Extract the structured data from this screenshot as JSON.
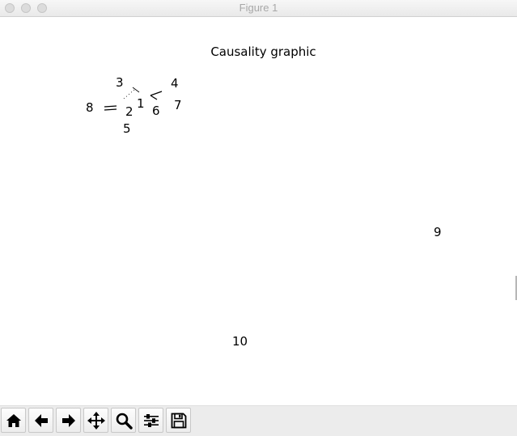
{
  "window": {
    "title": "Figure 1"
  },
  "figure": {
    "title": "Causality graphic",
    "nodes": [
      {
        "id": "n1",
        "label": "1"
      },
      {
        "id": "n2",
        "label": "2"
      },
      {
        "id": "n3",
        "label": "3"
      },
      {
        "id": "n4",
        "label": "4"
      },
      {
        "id": "n5",
        "label": "5"
      },
      {
        "id": "n6",
        "label": "6"
      },
      {
        "id": "n7",
        "label": "7"
      },
      {
        "id": "n8",
        "label": "8"
      },
      {
        "id": "n9",
        "label": "9"
      },
      {
        "id": "n10",
        "label": "10"
      }
    ]
  },
  "toolbar": {
    "buttons": [
      {
        "name": "home",
        "icon": "home-icon"
      },
      {
        "name": "back",
        "icon": "arrow-left-icon"
      },
      {
        "name": "forward",
        "icon": "arrow-right-icon"
      },
      {
        "name": "pan",
        "icon": "move-icon"
      },
      {
        "name": "zoom",
        "icon": "magnifier-icon"
      },
      {
        "name": "configure-subplots",
        "icon": "sliders-icon"
      },
      {
        "name": "save",
        "icon": "floppy-disk-icon"
      }
    ]
  }
}
